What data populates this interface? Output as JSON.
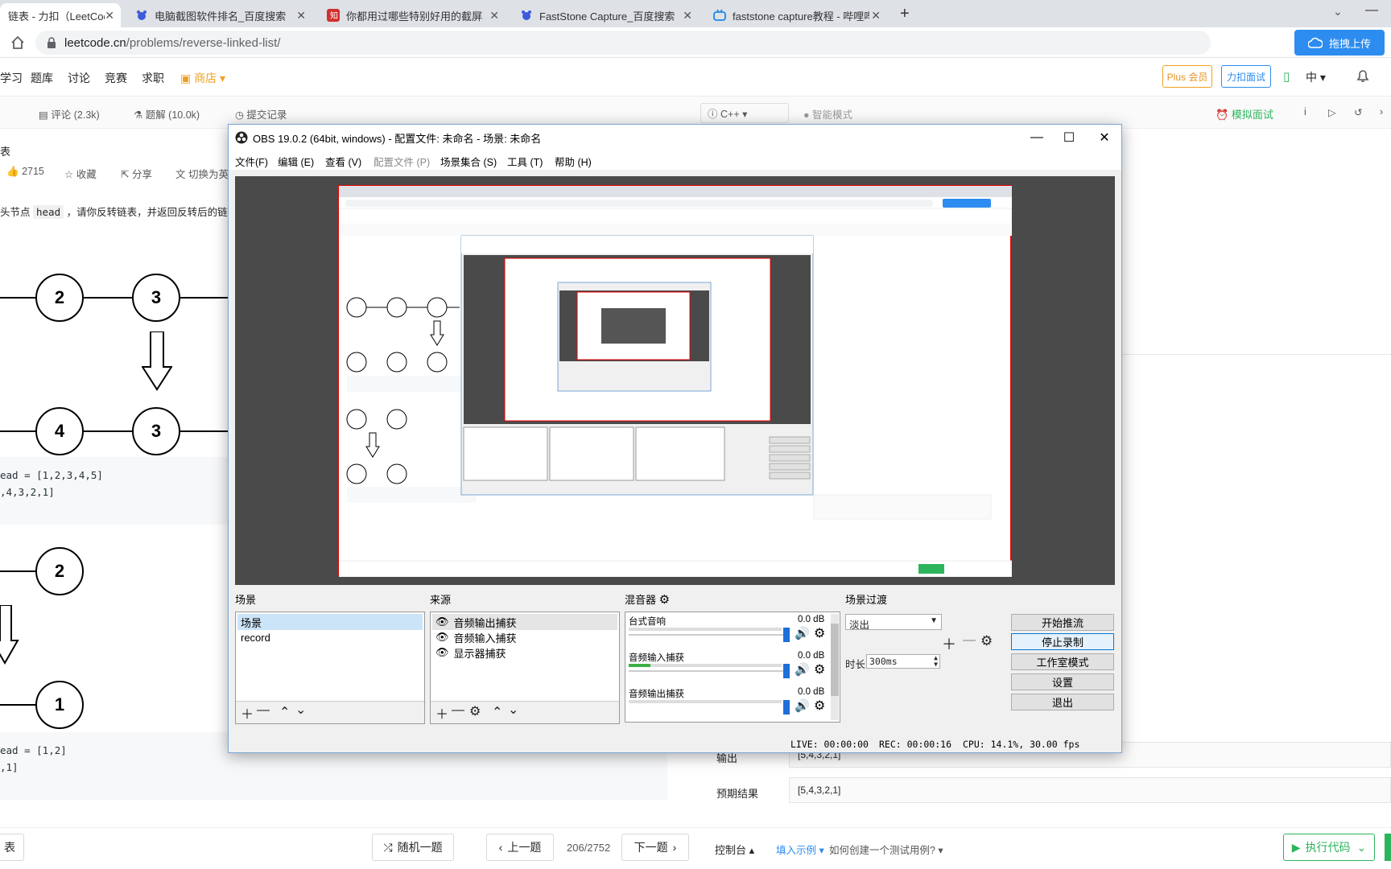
{
  "browser": {
    "tabs": [
      {
        "label": "链表 - 力扣（LeetCode",
        "icon": "leetcode-icon"
      },
      {
        "label": "电脑截图软件排名_百度搜索",
        "icon": "baidu-icon"
      },
      {
        "label": "你都用过哪些特别好用的截屏软",
        "icon": "zhihu-icon"
      },
      {
        "label": "FastStone Capture_百度搜索",
        "icon": "baidu-icon"
      },
      {
        "label": "faststone capture教程 - 哔哩哔",
        "icon": "bilibili-icon"
      }
    ],
    "url_host": "leetcode.cn",
    "url_path": "/problems/reverse-linked-list/",
    "upload_label": "拖拽上传"
  },
  "lc_nav": {
    "items": [
      "学习",
      "题库",
      "讨论",
      "竞赛",
      "求职"
    ],
    "store": "商店",
    "plus": "Plus 会员",
    "credit": "力扣面试",
    "lang": "中"
  },
  "lc_sub": {
    "comments": "评论 (2.3k)",
    "solutions": "题解 (10.0k)",
    "submissions": "提交记录",
    "language": "C++",
    "smart_mode": "智能模式",
    "mock": "模拟面试"
  },
  "problem": {
    "title_tail": "表",
    "likes": "2715",
    "favorite": "收藏",
    "share": "分享",
    "switch": "切换为英",
    "desc_pre": "头节点",
    "desc_code": "head",
    "desc_post": "，请你反转链表，并返回反转后的链",
    "ex1_in": "ead = [1,2,3,4,5]",
    "ex1_out": ",4,3,2,1]",
    "ex2_in": "ead = [1,2]",
    "ex2_out": ",1]",
    "nodes_row1": [
      "2",
      "3"
    ],
    "nodes_row2": [
      "4",
      "3"
    ],
    "nodes_ex2": [
      "2",
      "1"
    ]
  },
  "right_panel": {
    "output_label": "输出",
    "output_value": "[5,4,3,2,1]",
    "expected_label": "预期结果",
    "expected_value": "[5,4,3,2,1]"
  },
  "bottom": {
    "left_label": "表",
    "random": "随机一题",
    "prev": "上一题",
    "page": "206/2752",
    "next": "下一题",
    "console": "控制台",
    "fill_example": "填入示例",
    "how_testcase": "如何创建一个测试用例?",
    "run": "执行代码"
  },
  "obs": {
    "title": "OBS 19.0.2 (64bit, windows) - 配置文件: 未命名 - 场景: 未命名",
    "menu": [
      "文件(F)",
      "编辑 (E)",
      "查看 (V)",
      "配置文件 (P)",
      "场景集合 (S)",
      "工具 (T)",
      "帮助 (H)"
    ],
    "scenes_title": "场景",
    "scenes": [
      "场景",
      "record"
    ],
    "sources_title": "来源",
    "sources": [
      "音频输出捕获",
      "音频输入捕获",
      "显示器捕获"
    ],
    "mixer_title": "混音器",
    "mixer": [
      {
        "name": "台式音响",
        "db": "0.0 dB",
        "level": 0.0
      },
      {
        "name": "音频输入捕获",
        "db": "0.0 dB",
        "level": 0.14
      },
      {
        "name": "音频输出捕获",
        "db": "0.0 dB",
        "level": 0.0
      }
    ],
    "transitions_title": "场景过渡",
    "transition": "淡出",
    "duration_label": "时长",
    "duration": "300ms",
    "buttons": [
      "开始推流",
      "停止录制",
      "工作室模式",
      "设置",
      "退出"
    ],
    "status": {
      "live": "LIVE: 00:00:00",
      "rec": "REC: 00:00:16",
      "cpu": "CPU: 14.1%, 30.00 fps"
    }
  },
  "colors": {
    "accent": "#2d8cf0",
    "record_red": "#e00000",
    "green": "#2db55d"
  }
}
